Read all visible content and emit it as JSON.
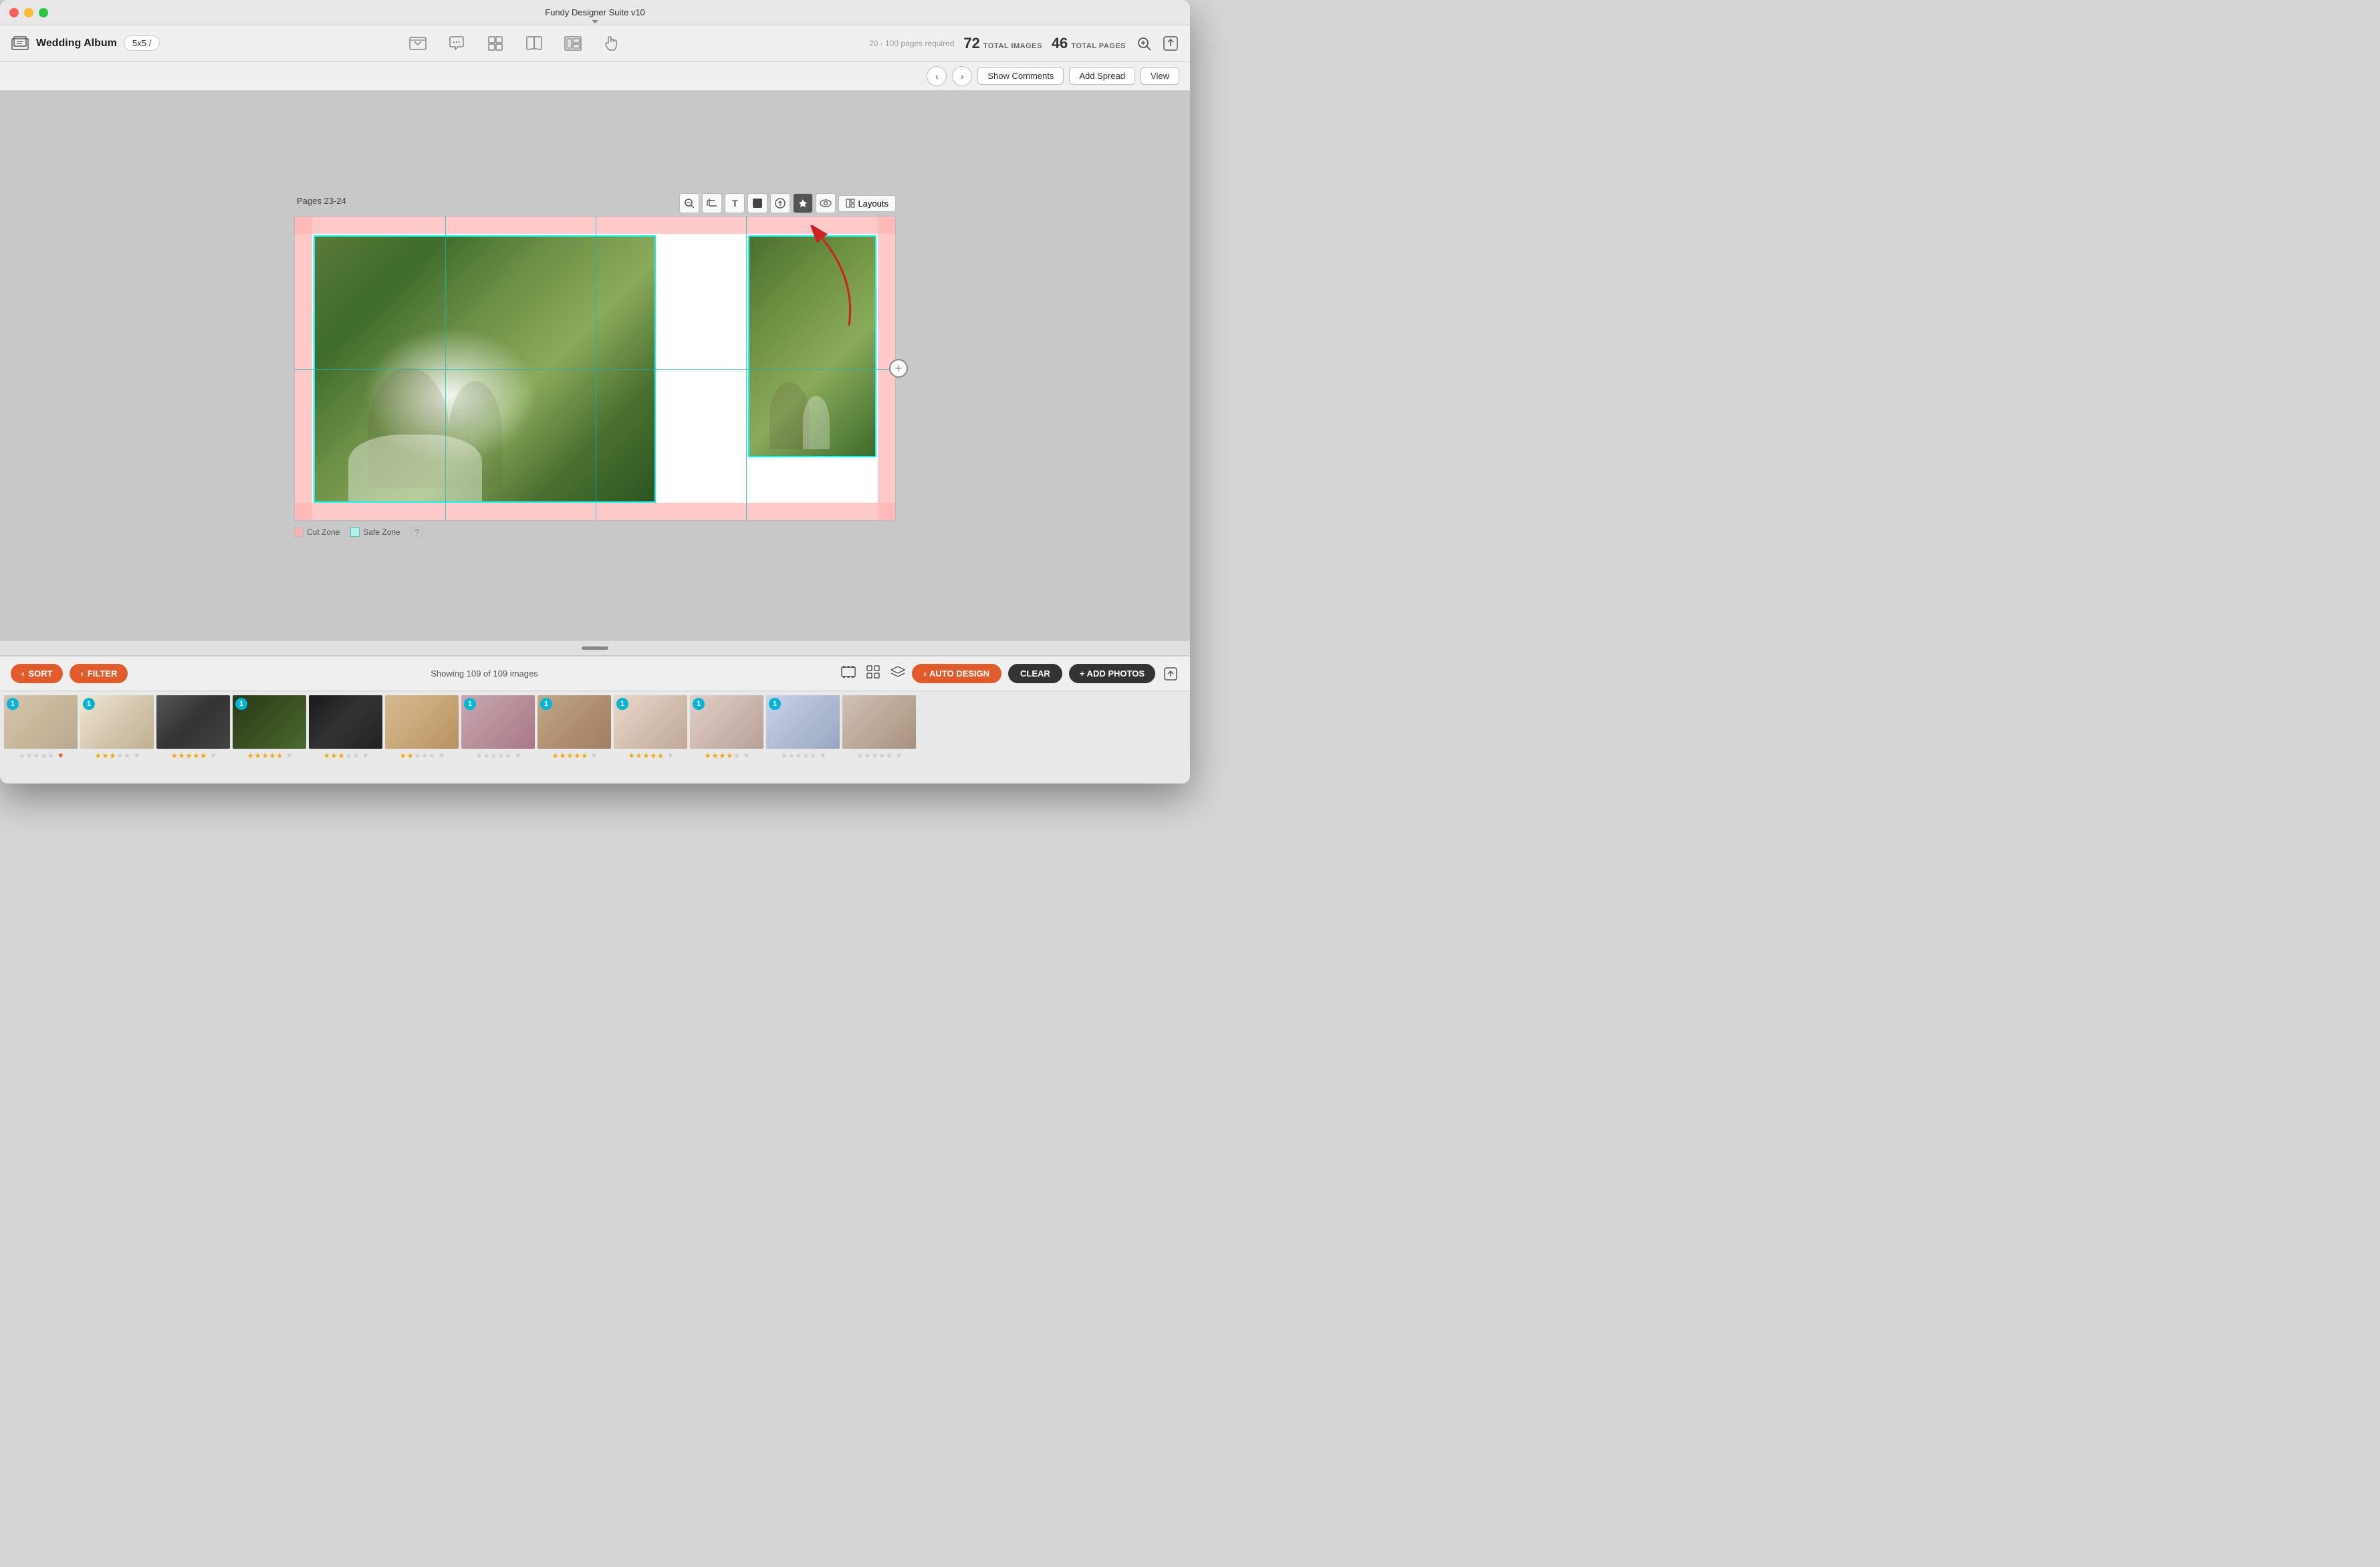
{
  "window": {
    "title": "Fundy Designer Suite v10",
    "trafficButtons": [
      "close",
      "minimize",
      "maximize"
    ]
  },
  "toolbar": {
    "albumTitle": "Wedding Album",
    "sizeLabel": "5x5",
    "pagesRequired": "20 - 100 pages required",
    "totalImages": "72",
    "totalImagesLabel": "TOTAL IMAGES",
    "totalPages": "46",
    "totalPagesLabel": "TOTAL PAGES"
  },
  "navToolbar": {
    "prevLabel": "‹",
    "nextLabel": "›",
    "showCommentsLabel": "Show Comments",
    "addSpreadLabel": "Add Spread",
    "viewLabel": "View"
  },
  "canvas": {
    "pagesLabel": "Pages 23-24",
    "tools": [
      "zoom-in",
      "crop",
      "text",
      "color",
      "export",
      "pin",
      "eye"
    ],
    "layoutsLabel": "Layouts",
    "legend": {
      "cutLabel": "Cut Zone",
      "safeLabel": "Safe Zone"
    }
  },
  "bottomPanel": {
    "sortLabel": "SORT",
    "filterLabel": "FILTER",
    "showingText": "Showing 109 of 109 images",
    "autoDesignLabel": "AUTO DESIGN",
    "clearLabel": "CLEAR",
    "addPhotosLabel": "+ ADD PHOTOS"
  },
  "thumbnails": [
    {
      "id": 1,
      "badge": "1",
      "stars": 0,
      "hasHeart": true,
      "colorClass": "thumb-color-1"
    },
    {
      "id": 2,
      "badge": "1",
      "stars": 3,
      "hasHeart": false,
      "colorClass": "thumb-color-2"
    },
    {
      "id": 3,
      "badge": null,
      "stars": 5,
      "hasHeart": false,
      "colorClass": "thumb-color-3"
    },
    {
      "id": 4,
      "badge": "1",
      "stars": 5,
      "hasHeart": false,
      "colorClass": "thumb-color-4"
    },
    {
      "id": 5,
      "badge": null,
      "stars": 3,
      "hasHeart": false,
      "colorClass": "thumb-color-5"
    },
    {
      "id": 6,
      "badge": null,
      "stars": 2,
      "hasHeart": false,
      "colorClass": "thumb-color-6"
    },
    {
      "id": 7,
      "badge": "1",
      "stars": 0,
      "hasHeart": false,
      "colorClass": "thumb-color-7"
    },
    {
      "id": 8,
      "badge": "1",
      "stars": 5,
      "hasHeart": false,
      "colorClass": "thumb-color-8"
    },
    {
      "id": 9,
      "badge": "1",
      "stars": 5,
      "hasHeart": false,
      "colorClass": "thumb-color-9"
    },
    {
      "id": 10,
      "badge": "1",
      "stars": 4,
      "hasHeart": false,
      "colorClass": "thumb-color-10"
    },
    {
      "id": 11,
      "badge": "1",
      "stars": 0,
      "hasHeart": false,
      "colorClass": "thumb-color-11"
    },
    {
      "id": 12,
      "badge": null,
      "stars": 0,
      "hasHeart": false,
      "colorClass": "thumb-color-12"
    }
  ]
}
